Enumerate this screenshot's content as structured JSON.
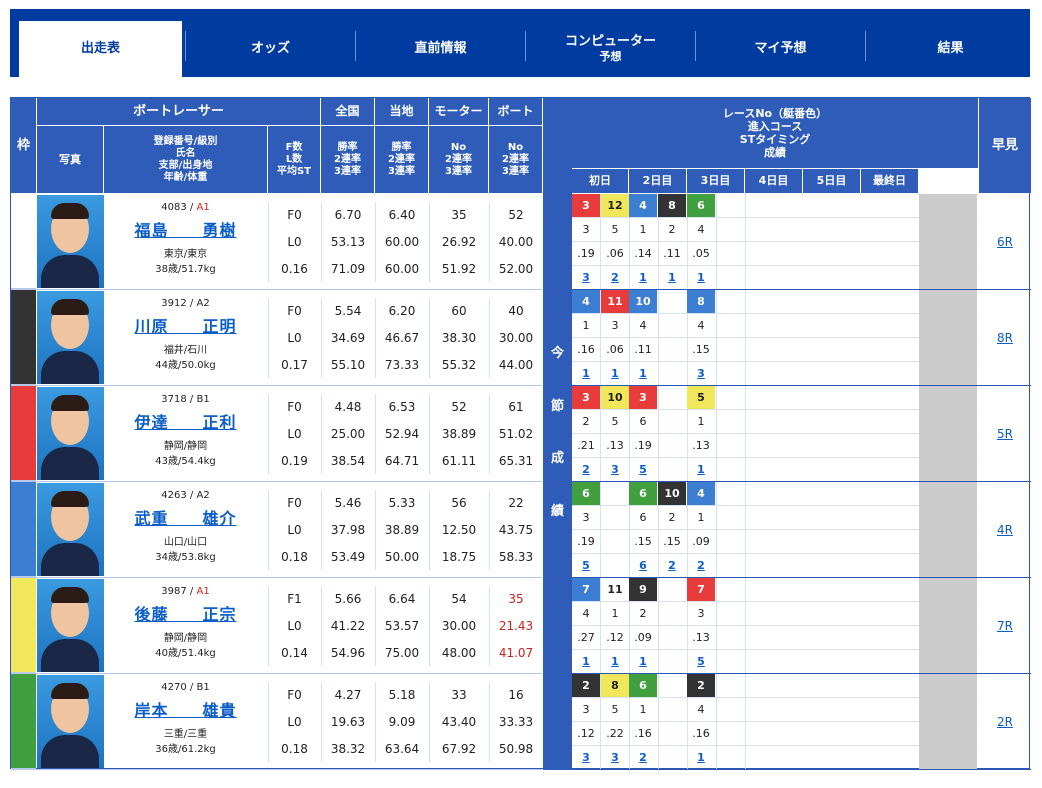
{
  "tabs": [
    {
      "label": "出走表",
      "sub": "",
      "active": true
    },
    {
      "label": "オッズ",
      "sub": "",
      "active": false
    },
    {
      "label": "直前情報",
      "sub": "",
      "active": false
    },
    {
      "label": "コンピューター",
      "sub": "予想",
      "active": false
    },
    {
      "label": "マイ予想",
      "sub": "",
      "active": false
    },
    {
      "label": "結果",
      "sub": "",
      "active": false
    }
  ],
  "header": {
    "waku": "枠",
    "racer": "ボートレーサー",
    "photo": "写真",
    "info": [
      "登録番号/級別",
      "氏名",
      "支部/出身地",
      "年齢/体重"
    ],
    "fl": [
      "F数",
      "L数",
      "平均ST"
    ],
    "zenkoku": "全国",
    "touchi": "当地",
    "motor": "モーター",
    "boat": "ボート",
    "rate3": [
      "勝率",
      "2連率",
      "3連率"
    ],
    "no3": [
      "No",
      "2連率",
      "3連率"
    ],
    "race_title": [
      "レースNo（艇番色）",
      "進入コース",
      "STタイミング",
      "成績"
    ],
    "days": [
      "初日",
      "2日目",
      "3日目",
      "4日目",
      "5日目",
      "最終日"
    ],
    "hayami": "早見",
    "konsetsu": [
      "今",
      "節",
      "成",
      "績"
    ]
  },
  "colors": {
    "waku": [
      "#ffffff",
      "#333333",
      "#e83c3c",
      "#3c7ed2",
      "#f0e85a",
      "#40a040"
    ]
  },
  "racers": [
    {
      "waku": "1",
      "reg": "4083",
      "cls": "A1",
      "name": "福島　　勇樹",
      "from": "東京/東京",
      "age": "38歳/51.7kg",
      "f": "F0",
      "l": "L0",
      "st": "0.16",
      "zen": [
        "6.70",
        "53.13",
        "71.09"
      ],
      "tou": [
        "6.40",
        "60.00",
        "60.00"
      ],
      "mot": [
        "35",
        "26.92",
        "51.92"
      ],
      "boa": [
        "52",
        "40.00",
        "52.00"
      ],
      "boa_red": false,
      "hy": "6R",
      "races": [
        {
          "no": "3",
          "c": "3",
          "st": ".19",
          "r": "3"
        },
        {
          "no": "12",
          "c": "5",
          "st": ".06",
          "r": "2"
        },
        {
          "no": "4",
          "c": "1",
          "st": ".14",
          "r": "1"
        },
        {
          "no": "8",
          "c": "2",
          "st": ".11",
          "r": "1"
        },
        {
          "no": "6",
          "c": "4",
          "st": ".05",
          "r": "1"
        }
      ]
    },
    {
      "waku": "2",
      "reg": "3912",
      "cls": "A2",
      "name": "川原　　正明",
      "from": "福井/石川",
      "age": "44歳/50.0kg",
      "f": "F0",
      "l": "L0",
      "st": "0.17",
      "zen": [
        "5.54",
        "34.69",
        "55.10"
      ],
      "tou": [
        "6.20",
        "46.67",
        "73.33"
      ],
      "mot": [
        "60",
        "38.30",
        "55.32"
      ],
      "boa": [
        "40",
        "30.00",
        "44.00"
      ],
      "boa_red": false,
      "hy": "8R",
      "races": [
        {
          "no": "4",
          "c": "1",
          "st": ".16",
          "r": "1"
        },
        {
          "no": "11",
          "c": "3",
          "st": ".06",
          "r": "1"
        },
        {
          "no": "10",
          "c": "4",
          "st": ".11",
          "r": "1"
        },
        {
          "no": "",
          "c": "",
          "st": "",
          "r": ""
        },
        {
          "no": "8",
          "c": "4",
          "st": ".15",
          "r": "3"
        }
      ]
    },
    {
      "waku": "3",
      "reg": "3718",
      "cls": "B1",
      "name": "伊達　　正利",
      "from": "静岡/静岡",
      "age": "43歳/54.4kg",
      "f": "F0",
      "l": "L0",
      "st": "0.19",
      "zen": [
        "4.48",
        "25.00",
        "38.54"
      ],
      "tou": [
        "6.53",
        "52.94",
        "64.71"
      ],
      "mot": [
        "52",
        "38.89",
        "61.11"
      ],
      "boa": [
        "61",
        "51.02",
        "65.31"
      ],
      "boa_red": false,
      "hy": "5R",
      "races": [
        {
          "no": "3",
          "c": "2",
          "st": ".21",
          "r": "2"
        },
        {
          "no": "10",
          "c": "5",
          "st": ".13",
          "r": "3"
        },
        {
          "no": "3",
          "c": "6",
          "st": ".19",
          "r": "5"
        },
        {
          "no": "",
          "c": "",
          "st": "",
          "r": ""
        },
        {
          "no": "5",
          "c": "1",
          "st": ".13",
          "r": "1"
        }
      ]
    },
    {
      "waku": "4",
      "reg": "4263",
      "cls": "A2",
      "name": "武重　　雄介",
      "from": "山口/山口",
      "age": "34歳/53.8kg",
      "f": "F0",
      "l": "L0",
      "st": "0.18",
      "zen": [
        "5.46",
        "37.98",
        "53.49"
      ],
      "tou": [
        "5.33",
        "38.89",
        "50.00"
      ],
      "mot": [
        "56",
        "12.50",
        "18.75"
      ],
      "boa": [
        "22",
        "43.75",
        "58.33"
      ],
      "boa_red": false,
      "hy": "4R",
      "races": [
        {
          "no": "6",
          "c": "3",
          "st": ".19",
          "r": "5"
        },
        {
          "no": "",
          "c": "",
          "st": "",
          "r": ""
        },
        {
          "no": "6",
          "c": "6",
          "st": ".15",
          "r": "6"
        },
        {
          "no": "10",
          "c": "2",
          "st": ".15",
          "r": "2"
        },
        {
          "no": "4",
          "c": "1",
          "st": ".09",
          "r": "2"
        }
      ]
    },
    {
      "waku": "5",
      "reg": "3987",
      "cls": "A1",
      "name": "後藤　　正宗",
      "from": "静岡/静岡",
      "age": "40歳/51.4kg",
      "f": "F1",
      "l": "L0",
      "st": "0.14",
      "zen": [
        "5.66",
        "41.22",
        "54.96"
      ],
      "tou": [
        "6.64",
        "53.57",
        "75.00"
      ],
      "mot": [
        "54",
        "30.00",
        "48.00"
      ],
      "boa": [
        "35",
        "21.43",
        "41.07"
      ],
      "boa_red": true,
      "hy": "7R",
      "races": [
        {
          "no": "7",
          "c": "4",
          "st": ".27",
          "r": "1"
        },
        {
          "no": "11",
          "c": "1",
          "st": ".12",
          "r": "1"
        },
        {
          "no": "9",
          "c": "2",
          "st": ".09",
          "r": "1"
        },
        {
          "no": "",
          "c": "",
          "st": "",
          "r": ""
        },
        {
          "no": "7",
          "c": "3",
          "st": ".13",
          "r": "5"
        }
      ]
    },
    {
      "waku": "6",
      "reg": "4270",
      "cls": "B1",
      "name": "岸本　　雄貴",
      "from": "三重/三重",
      "age": "36歳/61.2kg",
      "f": "F0",
      "l": "L0",
      "st": "0.18",
      "zen": [
        "4.27",
        "19.63",
        "38.32"
      ],
      "tou": [
        "5.18",
        "9.09",
        "63.64"
      ],
      "mot": [
        "33",
        "43.40",
        "67.92"
      ],
      "boa": [
        "16",
        "33.33",
        "50.98"
      ],
      "boa_red": false,
      "hy": "2R",
      "races": [
        {
          "no": "2",
          "c": "3",
          "st": ".12",
          "r": "3"
        },
        {
          "no": "8",
          "c": "5",
          "st": ".22",
          "r": "3"
        },
        {
          "no": "6",
          "c": "1",
          "st": ".16",
          "r": "2"
        },
        {
          "no": "",
          "c": "",
          "st": "",
          "r": ""
        },
        {
          "no": "2",
          "c": "4",
          "st": ".16",
          "r": "1"
        }
      ]
    }
  ]
}
